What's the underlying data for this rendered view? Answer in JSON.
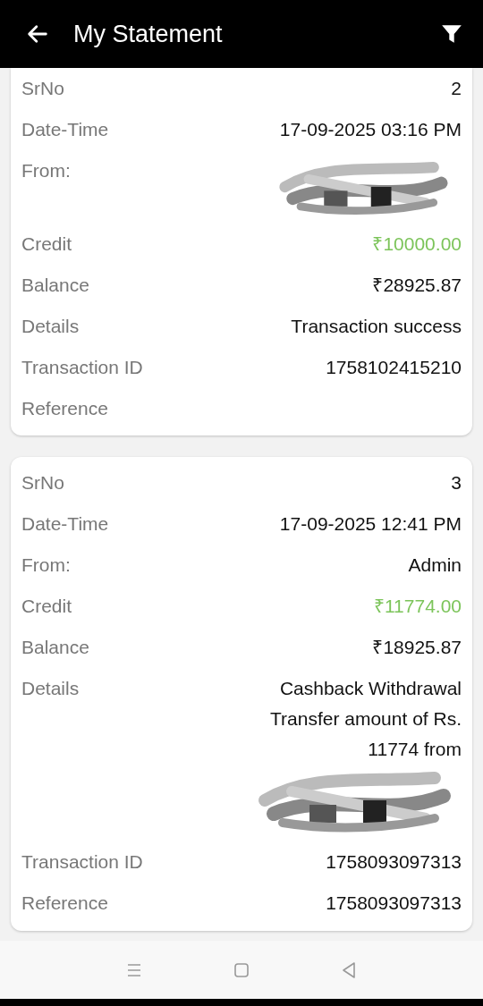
{
  "header": {
    "title": "My Statement"
  },
  "statements": [
    {
      "rows": [
        {
          "label": "SrNo",
          "value": "2",
          "kind": "plain"
        },
        {
          "label": "Date-Time",
          "value": "17-09-2025 03:16 PM",
          "kind": "plain"
        },
        {
          "label": "From:",
          "kind": "redacted"
        },
        {
          "label": "Credit",
          "value": "₹10000.00",
          "kind": "credit"
        },
        {
          "label": "Balance",
          "value": "₹28925.87",
          "kind": "plain"
        },
        {
          "label": "Details",
          "value": "Transaction success",
          "kind": "plain"
        },
        {
          "label": "Transaction ID",
          "value": "1758102415210",
          "kind": "plain"
        },
        {
          "label": "Reference",
          "kind": "plain"
        }
      ]
    },
    {
      "rows": [
        {
          "label": "SrNo",
          "value": "3",
          "kind": "plain"
        },
        {
          "label": "Date-Time",
          "value": "17-09-2025 12:41 PM",
          "kind": "plain"
        },
        {
          "label": "From:",
          "value": "Admin",
          "kind": "plain"
        },
        {
          "label": "Credit",
          "value": "₹11774.00",
          "kind": "credit"
        },
        {
          "label": "Balance",
          "value": "₹18925.87",
          "kind": "plain"
        },
        {
          "label": "Details",
          "value": "Cashback Withdrawal Transfer amount of Rs. 11774 from",
          "kind": "partly-redacted"
        },
        {
          "label": "Transaction ID",
          "value": "1758093097313",
          "kind": "plain"
        },
        {
          "label": "Reference",
          "value": "1758093097313",
          "kind": "plain"
        }
      ]
    }
  ]
}
